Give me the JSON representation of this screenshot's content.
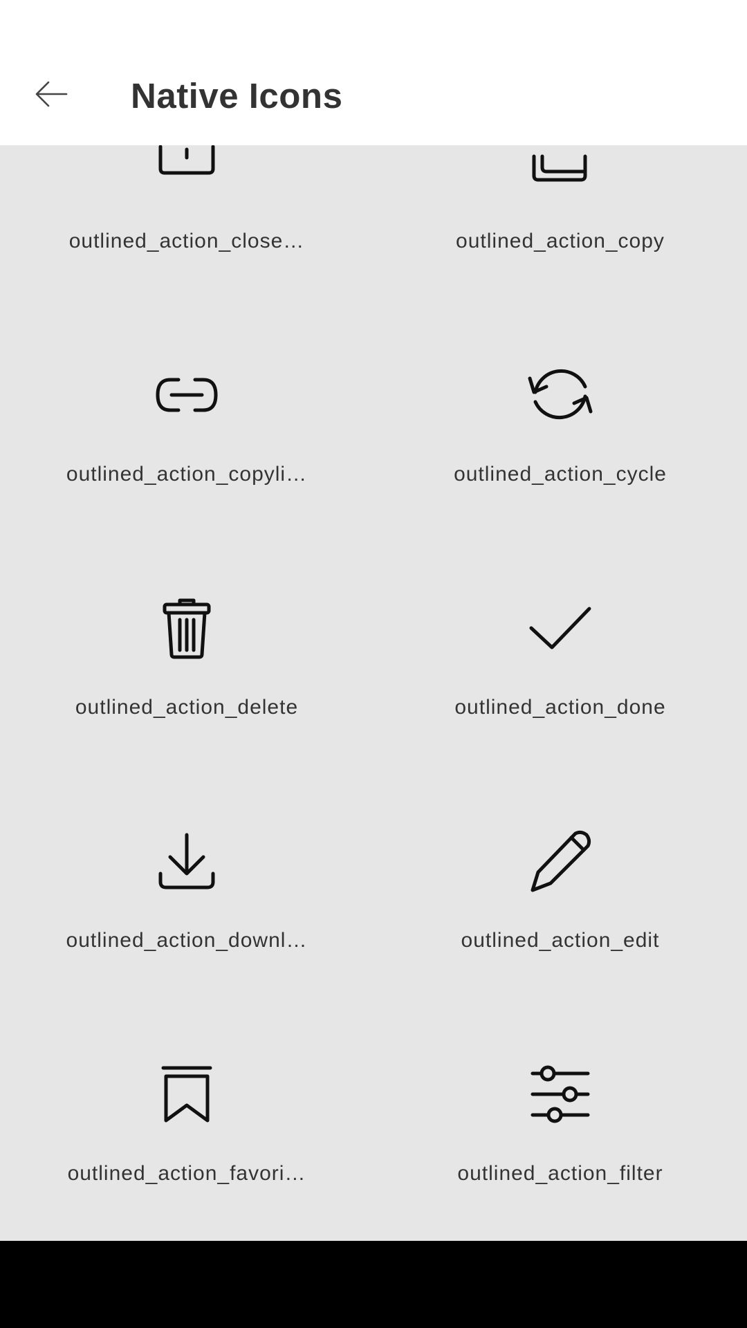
{
  "app_bar": {
    "title": "Native Icons"
  },
  "icons": [
    {
      "label": "outlined_action_close…",
      "icon": "close-box-icon"
    },
    {
      "label": "outlined_action_copy",
      "icon": "copy-icon"
    },
    {
      "label": "outlined_action_copyli…",
      "icon": "link-icon"
    },
    {
      "label": "outlined_action_cycle",
      "icon": "cycle-icon"
    },
    {
      "label": "outlined_action_delete",
      "icon": "trash-icon"
    },
    {
      "label": "outlined_action_done",
      "icon": "check-icon"
    },
    {
      "label": "outlined_action_downl…",
      "icon": "download-icon"
    },
    {
      "label": "outlined_action_edit",
      "icon": "pencil-icon"
    },
    {
      "label": "outlined_action_favori…",
      "icon": "bookmark-icon"
    },
    {
      "label": "outlined_action_filter",
      "icon": "filter-icon"
    }
  ]
}
